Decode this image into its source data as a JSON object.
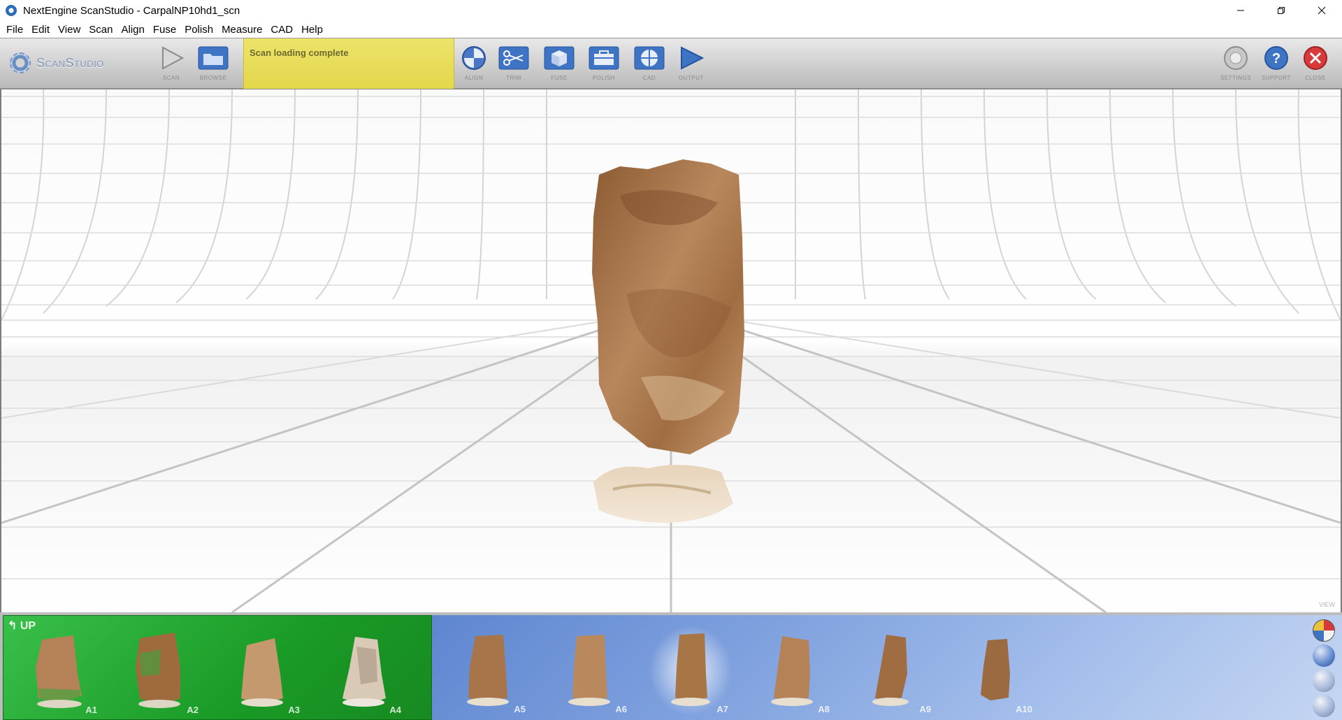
{
  "window": {
    "title": "NextEngine ScanStudio - CarpalNP10hd1_scn"
  },
  "menu": [
    "File",
    "Edit",
    "View",
    "Scan",
    "Align",
    "Fuse",
    "Polish",
    "Measure",
    "CAD",
    "Help"
  ],
  "toolbar": {
    "logo": "ScanStudio",
    "status": "Scan loading complete",
    "tools": {
      "scan": "Scan",
      "browse": "Browse",
      "align": "Align",
      "trim": "Trim",
      "fuse": "Fuse",
      "polish": "Polish",
      "cad": "CAD",
      "output": "Output",
      "settings": "Settings",
      "support": "Support",
      "close": "Close"
    }
  },
  "viewport": {
    "label": "View"
  },
  "filmstrip": {
    "up_label": "UP",
    "green_thumbs": [
      "A1",
      "A2",
      "A3",
      "A4"
    ],
    "blue_thumbs": [
      "A5",
      "A6",
      "A7",
      "A8",
      "A9",
      "A10"
    ],
    "selected": "A7"
  },
  "colors": {
    "status_bg": "#e6dc55",
    "green_panel": "#22a52f",
    "blue_panel": "#84a5e0",
    "object": "#a87547"
  }
}
